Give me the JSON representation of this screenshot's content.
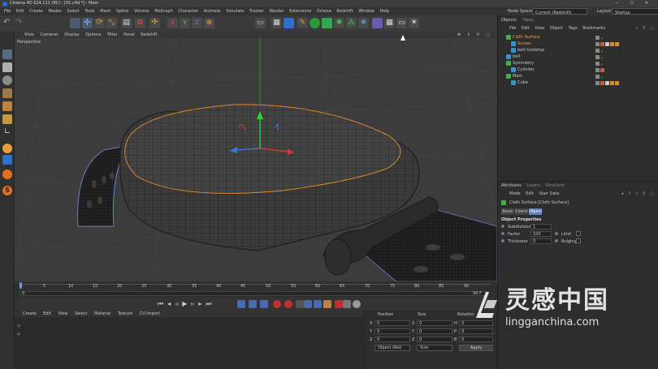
{
  "app": {
    "title": "Cinema 4D S24.111 (RC) - [01.c4d *] - Main",
    "window_controls": [
      "—",
      "☐",
      "✕"
    ]
  },
  "menubar": {
    "items": [
      "File",
      "Edit",
      "Create",
      "Modes",
      "Select",
      "Tools",
      "Mesh",
      "Spline",
      "Volume",
      "MoGraph",
      "Character",
      "Animate",
      "Simulate",
      "Tracker",
      "Render",
      "Extensions",
      "Octane",
      "Redshift",
      "Window",
      "Help"
    ],
    "node_space_label": "Node Space",
    "node_space_value": "Current (Redshift)",
    "layout_label": "Layout",
    "layout_value": "Startup"
  },
  "viewport": {
    "menu": [
      "View",
      "Cameras",
      "Display",
      "Options",
      "Filter",
      "Panel",
      "Redshift"
    ],
    "camera_label": "Perspective"
  },
  "timeline": {
    "ticks": [
      "0",
      "5",
      "10",
      "15",
      "20",
      "25",
      "30",
      "35",
      "40",
      "45",
      "50",
      "55",
      "60",
      "65",
      "70",
      "75",
      "80",
      "85",
      "90"
    ],
    "start_frame": "0",
    "end_frame": "90 F"
  },
  "material": {
    "menu": [
      "Create",
      "Edit",
      "View",
      "Select",
      "Material",
      "Texture",
      "CV-Import"
    ]
  },
  "coords": {
    "headers": [
      "Position",
      "Size",
      "Rotation"
    ],
    "rows": [
      {
        "axis": "X",
        "pos": "0",
        "size_axis": "X",
        "size": "0",
        "rot_axis": "H",
        "rot": "0"
      },
      {
        "axis": "Y",
        "pos": "0",
        "size_axis": "Y",
        "size": "0",
        "rot_axis": "P",
        "rot": "0"
      },
      {
        "axis": "Z",
        "pos": "0",
        "size_axis": "Z",
        "size": "0",
        "rot_axis": "B",
        "rot": "0"
      }
    ],
    "mode_value": "Object (Rel)",
    "size_mode_value": "Size",
    "apply_label": "Apply"
  },
  "objects": {
    "tabs": [
      "Objects",
      "Takes"
    ],
    "menu": [
      "File",
      "Edit",
      "View",
      "Object",
      "Tags",
      "Bookmarks"
    ],
    "items": [
      {
        "name": "Cloth Surface",
        "indent": 0,
        "highlight": true
      },
      {
        "name": "Screen",
        "indent": 1,
        "highlight": false
      },
      {
        "name": "belt holdetop",
        "indent": 1,
        "highlight": false
      },
      {
        "name": "belt",
        "indent": 0,
        "highlight": false
      },
      {
        "name": "Symmetry",
        "indent": 0,
        "highlight": false
      },
      {
        "name": "Cylinder",
        "indent": 1,
        "highlight": false
      },
      {
        "name": "Main",
        "indent": 0,
        "highlight": false
      },
      {
        "name": "Cube",
        "indent": 1,
        "highlight": false
      }
    ]
  },
  "attributes": {
    "tabs": [
      "Attributes",
      "Layers",
      "Structure"
    ],
    "menu": [
      "Mode",
      "Edit",
      "User Data"
    ],
    "object_name": "Cloth Surface [Cloth Surface]",
    "subtabs": [
      "Basic",
      "Coord.",
      "Object"
    ],
    "active_subtab": "Object",
    "section_title": "Object Properties",
    "fields": [
      {
        "label": "Subdivisions",
        "value": "1"
      },
      {
        "label": "Factor",
        "value": "100"
      },
      {
        "label": "Thickness",
        "value": "0"
      }
    ],
    "checkboxes": [
      {
        "label": "Limit"
      },
      {
        "label": "Bulging"
      }
    ]
  },
  "watermark": {
    "text": "灵感中国",
    "url": "lingganchina.com"
  },
  "colors": {
    "accent": "#f08c1e",
    "selection": "#5a7fb8",
    "highlight_text": "#f0a040",
    "green_axis": "#3ad04a",
    "red_axis": "#d03a3a",
    "blue_axis": "#3a78d0"
  }
}
